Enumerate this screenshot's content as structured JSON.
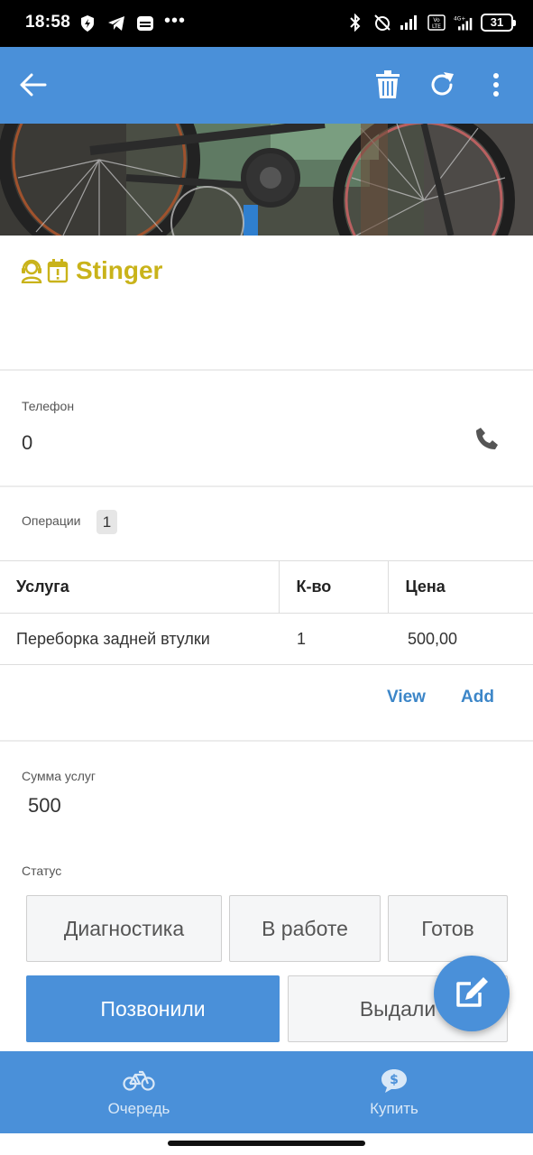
{
  "status_bar": {
    "time": "18:58",
    "battery": "31",
    "network": "4G+",
    "volte": "Vo LTE"
  },
  "app_bar": {
    "back_icon": "arrow-left-icon",
    "delete_icon": "trash-icon",
    "refresh_icon": "refresh-icon",
    "menu_icon": "more-vertical-icon"
  },
  "hero": {
    "description_icon": "bicycle-photo"
  },
  "title": {
    "name": "Stinger",
    "color": "#c9b31a",
    "icons": [
      "support-agent-icon",
      "calendar-alert-icon"
    ]
  },
  "phone": {
    "label": "Телефон",
    "value": "0",
    "icon": "phone-icon"
  },
  "operations": {
    "label": "Операции",
    "count": "1"
  },
  "table": {
    "headers": [
      "Услуга",
      "К-во",
      "Цена"
    ],
    "rows": [
      [
        "Переборка задней втулки",
        "1",
        "500,00"
      ]
    ]
  },
  "actions": {
    "view_label": "View",
    "add_label": "Add"
  },
  "sum": {
    "label": "Сумма услуг",
    "value": "500"
  },
  "status": {
    "label": "Статус",
    "buttons": [
      "Диагностика",
      "В работе",
      "Готов",
      "Позвонили",
      "Выдали"
    ],
    "active": "Позвонили"
  },
  "fab": {
    "icon": "edit-icon"
  },
  "bottom_nav": {
    "items": [
      {
        "label": "Очередь",
        "icon": "bicycle-icon"
      },
      {
        "label": "Купить",
        "icon": "dollar-chat-icon"
      }
    ]
  },
  "colors": {
    "primary": "#4a90d9",
    "accent_title": "#c9b31a",
    "link": "#3c86c8"
  }
}
